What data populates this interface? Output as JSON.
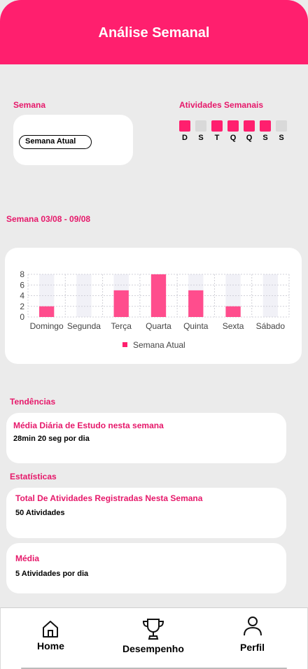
{
  "header": {
    "title": "Análise Semanal"
  },
  "week_section": {
    "label": "Semana",
    "selected": "Semana Atual"
  },
  "activities_section": {
    "label": "Atividades Semanais",
    "days": [
      {
        "letter": "D",
        "active": true
      },
      {
        "letter": "S",
        "active": false
      },
      {
        "letter": "T",
        "active": true
      },
      {
        "letter": "Q",
        "active": true
      },
      {
        "letter": "Q",
        "active": true
      },
      {
        "letter": "S",
        "active": true
      },
      {
        "letter": "S",
        "active": false
      }
    ]
  },
  "range_label": "Semana 03/08 - 09/08",
  "chart_data": {
    "type": "bar",
    "categories": [
      "Domingo",
      "Segunda",
      "Terça",
      "Quarta",
      "Quinta",
      "Sexta",
      "Sábado"
    ],
    "series": [
      {
        "name": "Semana Atual",
        "values": [
          2,
          0,
          5,
          8,
          5,
          2,
          0
        ]
      }
    ],
    "y_ticks": [
      "0",
      "2",
      "4",
      "6",
      "8"
    ],
    "ylim": [
      0,
      8
    ],
    "grid": true,
    "legend": "bottom"
  },
  "trends": {
    "label": "Tendências",
    "card": {
      "title": "Média Diária de Estudo nesta semana",
      "value": "28min 20 seg por dia"
    }
  },
  "stats": {
    "label": "Estatísticas",
    "cards": [
      {
        "title": "Total De Atividades Registradas Nesta Semana",
        "value": "50 Atividades"
      },
      {
        "title": "Média",
        "value": "5 Atividades por dia"
      }
    ]
  },
  "nav": {
    "items": [
      {
        "label": "Home",
        "icon": "home-icon"
      },
      {
        "label": "Desempenho",
        "icon": "trophy-icon"
      },
      {
        "label": "Perfil",
        "icon": "user-icon"
      }
    ]
  },
  "colors": {
    "accent": "#ff1f6e",
    "inactive": "#d9d9d9",
    "bar": "#ff4d8d",
    "bar_bg": "#f1f1f7"
  }
}
